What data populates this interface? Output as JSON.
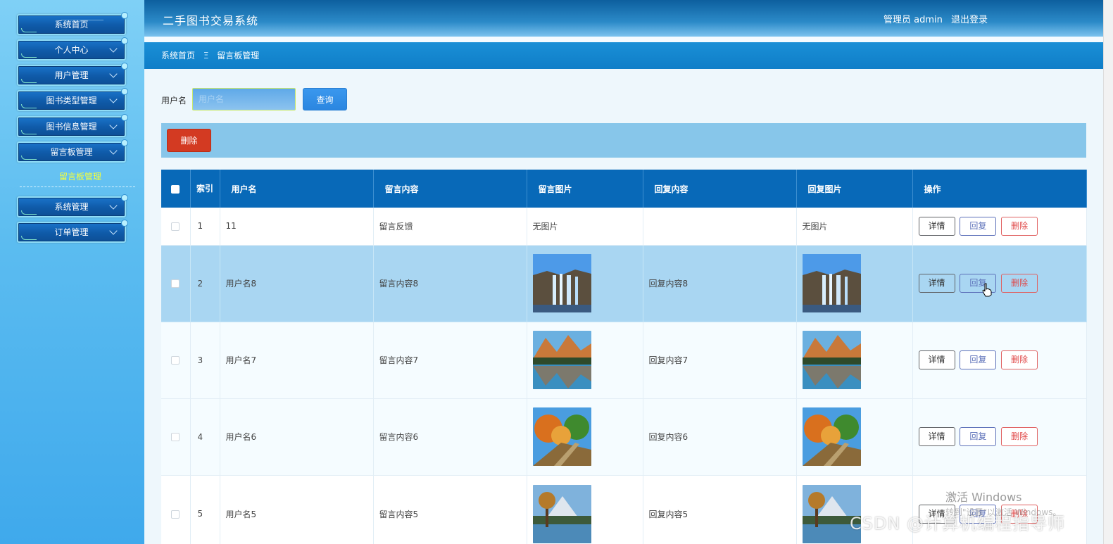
{
  "sidebar": {
    "items": [
      {
        "label": "系统首页"
      },
      {
        "label": "个人中心"
      },
      {
        "label": "用户管理"
      },
      {
        "label": "图书类型管理"
      },
      {
        "label": "图书信息管理"
      },
      {
        "label": "留言板管理"
      },
      {
        "label": "系统管理"
      },
      {
        "label": "订单管理"
      }
    ],
    "submenu_label": "留言板管理",
    "submenu_color": "#f5ff3a"
  },
  "header": {
    "title": "二手图书交易系统",
    "user": "管理员 admin",
    "logout": "退出登录"
  },
  "breadcrumb": {
    "home": "系统首页",
    "separator": "Ξ",
    "current": "留言板管理"
  },
  "search": {
    "label": "用户名",
    "placeholder": "用户名",
    "button": "查询"
  },
  "toolbar": {
    "delete_label": "删除"
  },
  "table": {
    "headers": {
      "index": "索引",
      "username": "用户名",
      "content": "留言内容",
      "image": "留言图片",
      "reply": "回复内容",
      "reply_image": "回复图片",
      "actions": "操作"
    },
    "no_image": "无图片",
    "actions": {
      "detail": "详情",
      "reply": "回复",
      "delete": "删除"
    },
    "rows": [
      {
        "index": "1",
        "username": "11",
        "content": "留言反馈",
        "reply": "",
        "image": "none"
      },
      {
        "index": "2",
        "username": "用户名8",
        "content": "留言内容8",
        "reply": "回复内容8",
        "image": "waterfall"
      },
      {
        "index": "3",
        "username": "用户名7",
        "content": "留言内容7",
        "reply": "回复内容7",
        "image": "lake-mountain"
      },
      {
        "index": "4",
        "username": "用户名6",
        "content": "留言内容6",
        "reply": "回复内容6",
        "image": "autumn-trees"
      },
      {
        "index": "5",
        "username": "用户名5",
        "content": "留言内容5",
        "reply": "回复内容5",
        "image": "lake-tree"
      }
    ]
  },
  "overlay": {
    "watermark_title": "激活 Windows",
    "watermark_sub": "转到\"设置\"以激活 Windows。",
    "csdn": "CSDN @计算机编程指导师"
  },
  "colors": {
    "header": "#0d5f9e",
    "breadcrumb": "#0f7ec8",
    "table_header": "#0869b8",
    "toolbar": "#87c6ea",
    "highlight_row": "#a9d6f2",
    "delete_red": "#d33a22",
    "search_blue": "#2b86e0"
  }
}
